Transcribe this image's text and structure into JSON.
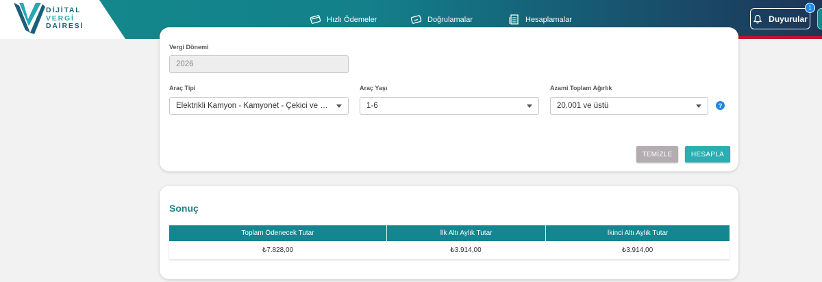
{
  "header": {
    "logo": {
      "line1": "DİJİTAL",
      "line2": "VERGİ",
      "line3": "DAİRESİ"
    },
    "nav": [
      {
        "label": "Hızlı Ödemeler",
        "icon": "card-icon"
      },
      {
        "label": "Doğrulamalar",
        "icon": "ticket-icon"
      },
      {
        "label": "Hesaplamalar",
        "icon": "receipt-icon"
      }
    ],
    "announcements": {
      "label": "Duyurular",
      "badge": "1",
      "icon": "bell-icon"
    },
    "colors": {
      "primary": "#138a8c",
      "dark": "#1d3557",
      "accent_red": "#c8102e"
    }
  },
  "form": {
    "period": {
      "label": "Vergi Dönemi",
      "value": "2026"
    },
    "vehicle_type": {
      "label": "Araç Tipi",
      "value": "Elektrikli Kamyon - Kamyonet - Çekici ve Benzeri"
    },
    "vehicle_age": {
      "label": "Araç Yaşı",
      "value": "1-6"
    },
    "max_weight": {
      "label": "Azami Toplam Ağırlık",
      "value": "20.001 ve üstü"
    },
    "help": "?",
    "clear_label": "TEMİZLE",
    "calc_label": "HESAPLA"
  },
  "result": {
    "title": "Sonuç",
    "columns": [
      "Toplam Ödenecek Tutar",
      "İlk Altı Aylık Tutar",
      "İkinci Altı Aylık Tutar"
    ],
    "row": [
      "₺7.828,00",
      "₺3.914,00",
      "₺3.914,00"
    ]
  }
}
